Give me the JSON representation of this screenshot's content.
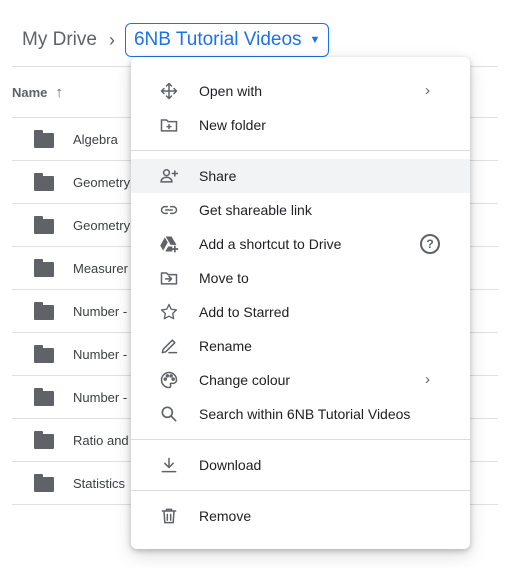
{
  "breadcrumb": {
    "root": "My Drive",
    "separator": "›",
    "current": "6NB Tutorial Videos"
  },
  "list": {
    "header": "Name",
    "sort_arrow": "↑",
    "rows": [
      "Algebra",
      "Geometry",
      "Geometry",
      "Measurer",
      "Number -",
      "Number -",
      "Number -",
      "Ratio and",
      "Statistics"
    ]
  },
  "menu": {
    "open_with": "Open with",
    "new_folder": "New folder",
    "share": "Share",
    "get_link": "Get shareable link",
    "add_shortcut": "Add a shortcut to Drive",
    "move_to": "Move to",
    "add_starred": "Add to Starred",
    "rename": "Rename",
    "change_colour": "Change colour",
    "search_within": "Search within 6NB Tutorial Videos",
    "download": "Download",
    "remove": "Remove",
    "submenu_arrow": "›",
    "help_glyph": "?"
  },
  "colors": {
    "accent": "#1a73e8",
    "icon": "#5f6368",
    "highlight": "#f1f3f4"
  }
}
